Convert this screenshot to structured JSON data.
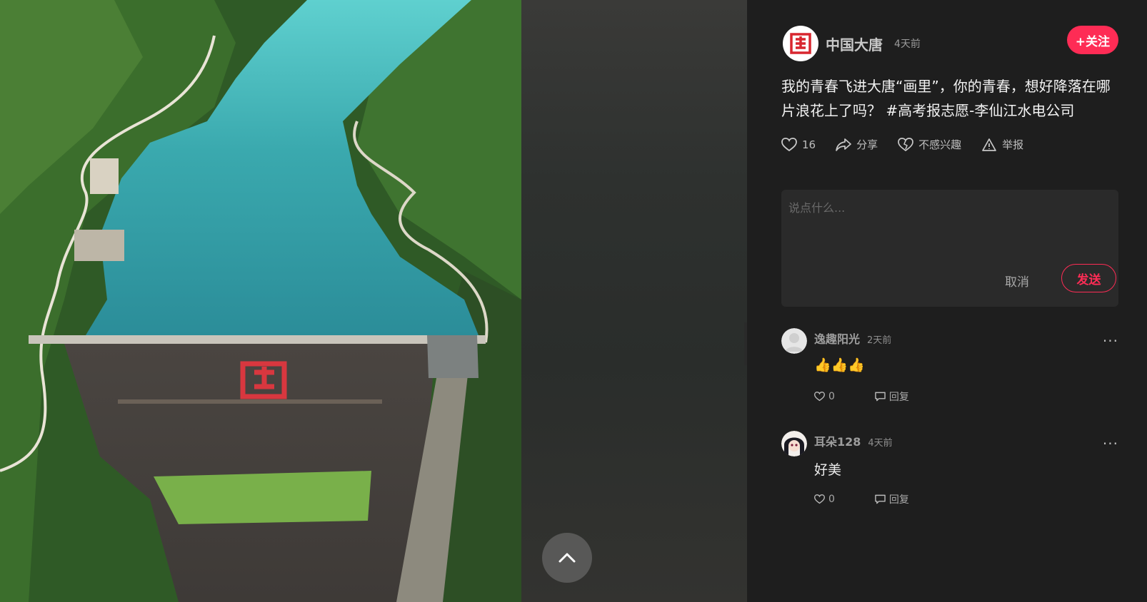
{
  "post": {
    "author_name": "中国大唐",
    "time": "4天前",
    "follow_label": "+关注",
    "description": "我的青春飞进大唐“画里”，你的青春，想好降落在哪片浪花上了吗？ #高考报志愿-李仙江水电公司"
  },
  "actions": {
    "like_count": "16",
    "share_label": "分享",
    "not_interested_label": "不感兴趣",
    "report_label": "举报"
  },
  "comment_box": {
    "placeholder": "说点什么...",
    "cancel_label": "取消",
    "send_label": "发送"
  },
  "comments": [
    {
      "user": "逸趣阳光",
      "time": "2天前",
      "text": "👍👍👍",
      "likes": "0",
      "reply_label": "回复",
      "more": "..."
    },
    {
      "user": "耳朵128",
      "time": "4天前",
      "text": "好美",
      "likes": "0",
      "reply_label": "回复",
      "more": "..."
    }
  ],
  "colors": {
    "accent": "#fe2c55",
    "sidebar_bg": "#1e1e1e",
    "input_bg": "#2a2a2a"
  },
  "icons": [
    "heart-icon",
    "share-icon",
    "dislike-heart-icon",
    "warning-icon",
    "chevron-up-icon",
    "chevron-right-icon",
    "comment-icon",
    "more-icon"
  ]
}
